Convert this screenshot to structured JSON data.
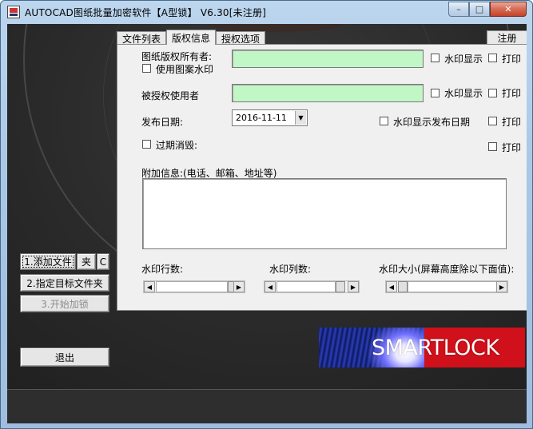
{
  "window": {
    "title": "AUTOCAD图纸批量加密软件【A型锁】 V6.30[未注册]",
    "controls": {
      "minimize": "–",
      "maximize": "□",
      "close": "✕"
    }
  },
  "tabs": [
    {
      "label": "文件列表",
      "active": false
    },
    {
      "label": "版权信息",
      "active": true
    },
    {
      "label": "授权选项",
      "active": false
    }
  ],
  "register_tab": "注册",
  "copyright": {
    "owner_label": "图纸版权所有者:",
    "owner_value": "",
    "use_pattern_watermark": "使用图案水印",
    "licensee_label": "被授权使用者",
    "licensee_value": "",
    "watermark_show_1": "水印显示",
    "print_1": "打印",
    "watermark_show_2": "水印显示",
    "print_2": "打印",
    "publish_date_label": "发布日期:",
    "publish_date_value": "2016-11-11",
    "watermark_show_date": "水印显示发布日期",
    "print_3": "打印",
    "expire_destroy": "过期消毁:",
    "print_4": "打印",
    "extra_info_label": "附加信息:(电话、邮箱、地址等)",
    "extra_info_value": "",
    "rows_label": "水印行数:",
    "cols_label": "水印列数:",
    "size_label": "水印大小(屏幕高度除以下面值):"
  },
  "sliders": {
    "rows_position": 0.85,
    "cols_position": 0.85,
    "size_position": 0.0
  },
  "left_buttons": {
    "add_file": "1.添加文件",
    "folder": "夹",
    "clear": "C",
    "target_folder": "2.指定目标文件夹",
    "start_lock": "3.开始加锁",
    "exit": "退出"
  },
  "logo": {
    "text": "SMARTLOCK"
  },
  "colors": {
    "field_green": "#c1f7c4",
    "logo_red": "#d0101a",
    "logo_blue": "#1a2a9a"
  }
}
